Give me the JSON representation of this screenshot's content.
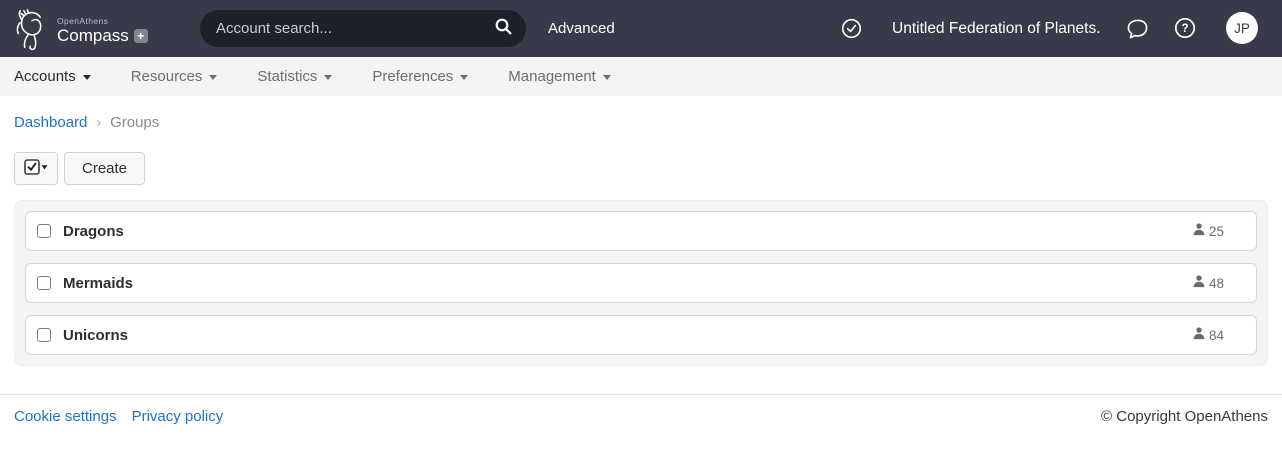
{
  "topbar": {
    "logo": {
      "brand_small": "OpenAthens",
      "brand_large": "Compass",
      "plus": "+"
    },
    "search": {
      "placeholder": "Account search..."
    },
    "advanced_label": "Advanced",
    "org_name": "Untitled Federation of Planets.",
    "avatar_initials": "JP"
  },
  "nav": {
    "items": [
      {
        "label": "Accounts"
      },
      {
        "label": "Resources"
      },
      {
        "label": "Statistics"
      },
      {
        "label": "Preferences"
      },
      {
        "label": "Management"
      }
    ]
  },
  "breadcrumb": {
    "dashboard": "Dashboard",
    "separator": "›",
    "current": "Groups"
  },
  "toolbar": {
    "create_label": "Create"
  },
  "groups": [
    {
      "name": "Dragons",
      "count": "25"
    },
    {
      "name": "Mermaids",
      "count": "48"
    },
    {
      "name": "Unicorns",
      "count": "84"
    }
  ],
  "footer": {
    "links": [
      "Cookie settings",
      "Privacy policy"
    ],
    "copyright": "© Copyright OpenAthens"
  },
  "colors": {
    "topbar_bg": "#383a4a",
    "search_pill_bg": "#1e212b",
    "nav_bg": "#f4f4f4",
    "link_blue": "#1f72cd",
    "panel_bg": "#f4f4f5",
    "row_border": "#d8d8d8"
  }
}
